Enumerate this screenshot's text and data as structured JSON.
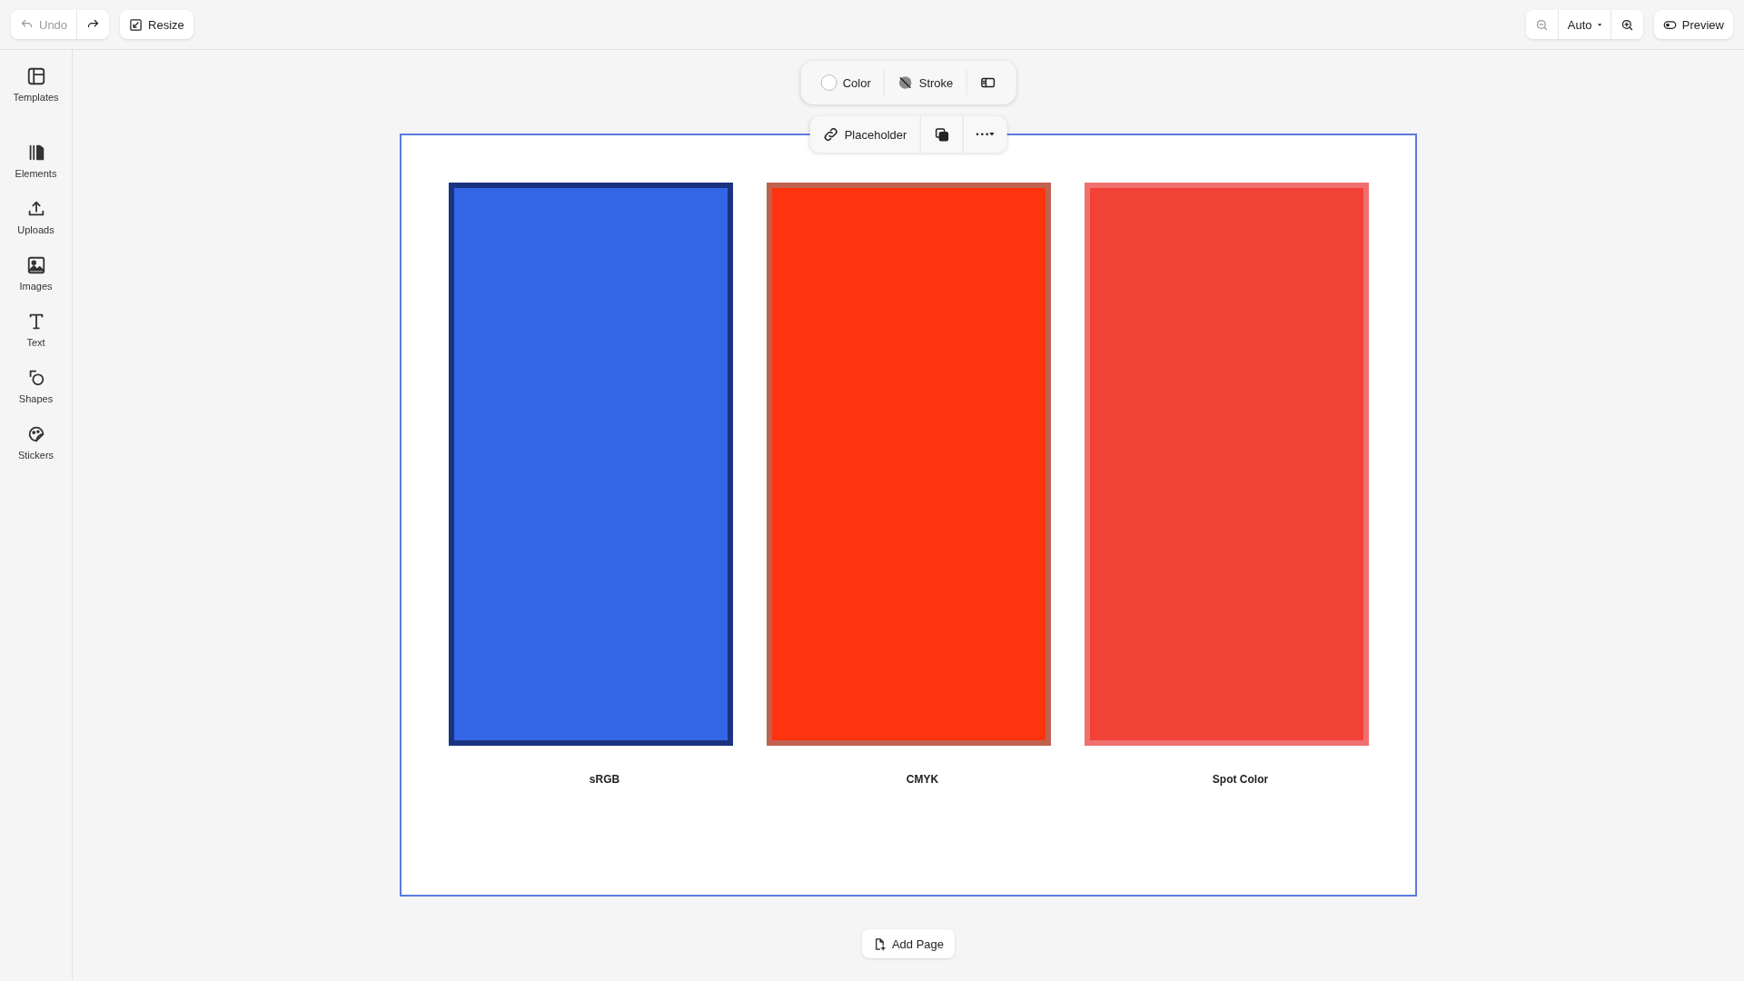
{
  "top_bar": {
    "undo": {
      "label": "Undo",
      "disabled": true
    },
    "redo": {
      "disabled": false
    },
    "resize": {
      "label": "Resize"
    },
    "zoom_out": {
      "disabled": true
    },
    "zoom_select": {
      "value": "Auto"
    },
    "preview": {
      "label": "Preview"
    }
  },
  "sidebar": {
    "items": [
      {
        "label": "Templates"
      },
      {
        "label": "Elements"
      },
      {
        "label": "Uploads"
      },
      {
        "label": "Images"
      },
      {
        "label": "Text"
      },
      {
        "label": "Shapes"
      },
      {
        "label": "Stickers"
      }
    ]
  },
  "style_toolbar": {
    "color": {
      "label": "Color"
    },
    "stroke": {
      "label": "Stroke"
    }
  },
  "page_toolbar": {
    "placeholder": {
      "label": "Placeholder"
    }
  },
  "page": {
    "selected": true,
    "swatches": [
      {
        "label": "sRGB",
        "color": "#3366e6"
      },
      {
        "label": "CMYK",
        "color": "#ff330d"
      },
      {
        "label": "Spot Color",
        "color": "#f24136"
      }
    ]
  },
  "add_page": {
    "label": "Add Page"
  }
}
